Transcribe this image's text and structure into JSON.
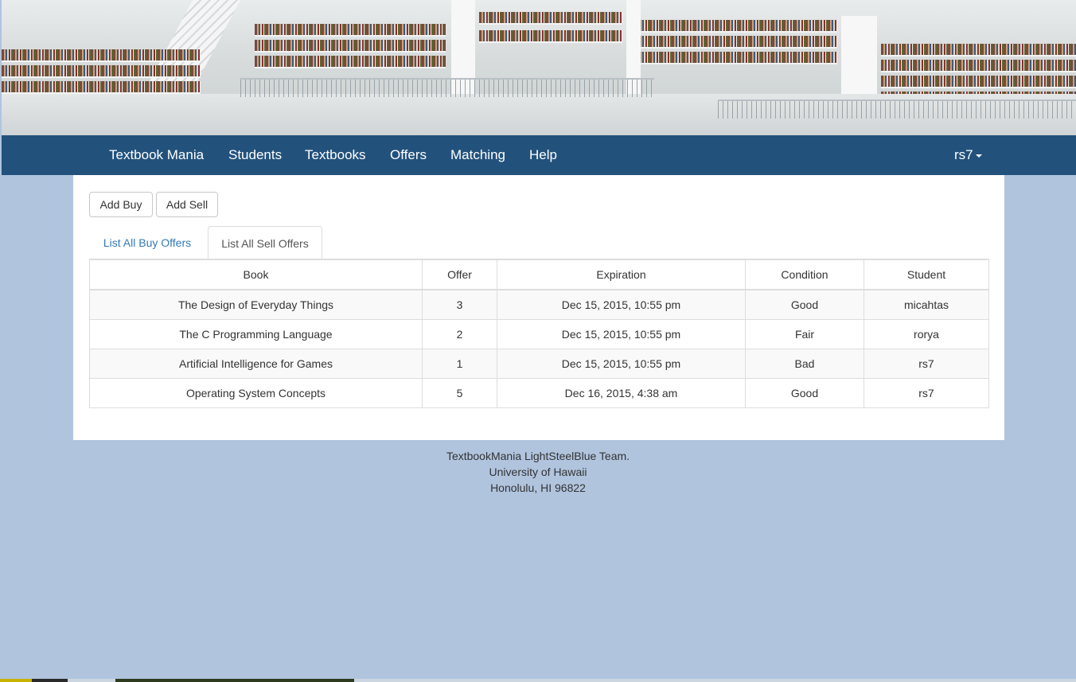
{
  "banner": {
    "alt": "library banner image"
  },
  "nav": {
    "brand": "Textbook Mania",
    "items": [
      "Students",
      "Textbooks",
      "Offers",
      "Matching",
      "Help"
    ],
    "user": "rs7"
  },
  "actions": {
    "add_buy": "Add Buy",
    "add_sell": "Add Sell"
  },
  "tabs": [
    {
      "label": "List All Buy Offers",
      "active": false
    },
    {
      "label": "List All Sell Offers",
      "active": true
    }
  ],
  "table": {
    "headers": [
      "Book",
      "Offer",
      "Expiration",
      "Condition",
      "Student"
    ],
    "rows": [
      [
        "The Design of Everyday Things",
        "3",
        "Dec 15, 2015, 10:55 pm",
        "Good",
        "micahtas"
      ],
      [
        "The C Programming Language",
        "2",
        "Dec 15, 2015, 10:55 pm",
        "Fair",
        "rorya"
      ],
      [
        "Artificial Intelligence for Games",
        "1",
        "Dec 15, 2015, 10:55 pm",
        "Bad",
        "rs7"
      ],
      [
        "Operating System Concepts",
        "5",
        "Dec 16, 2015, 4:38 am",
        "Good",
        "rs7"
      ]
    ]
  },
  "footer": {
    "line1": "TextbookMania LightSteelBlue Team.",
    "line2": "University of Hawaii",
    "line3": "Honolulu, HI 96822"
  },
  "colors": {
    "navbar": "#22527c",
    "page_background": "#b0c4de",
    "link": "#337ab7"
  }
}
